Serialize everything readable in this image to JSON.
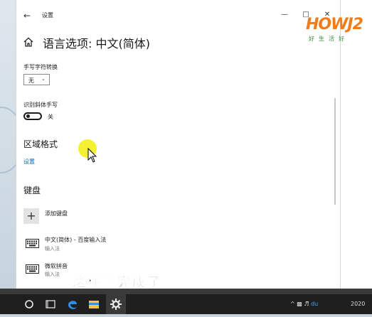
{
  "window": {
    "app_title": "设置",
    "page_title": "语言选项: 中文(简体)"
  },
  "handwriting": {
    "conversion_label": "手写字符转换",
    "conversion_value": "无",
    "italic_label": "识别斜体手写",
    "italic_toggle": "关"
  },
  "region": {
    "heading": "区域格式",
    "settings_link": "设置"
  },
  "keyboard": {
    "heading": "键盘",
    "add_label": "添加键盘",
    "items": [
      {
        "name": "中文(简体) - 百度输入法",
        "sub": "输入法"
      },
      {
        "name": "微软拼音",
        "sub": "输入法"
      }
    ]
  },
  "overlay": {
    "subtitle": "这样就完成了",
    "watermark_logo": "HOWJ2",
    "watermark_sub": "好生活好"
  },
  "taskbar": {
    "clock": "2020",
    "tray_chevron": "^"
  },
  "colors": {
    "accent": "#0067c0",
    "highlight": "#f3ee1c",
    "taskbar": "#1f1f1f"
  }
}
